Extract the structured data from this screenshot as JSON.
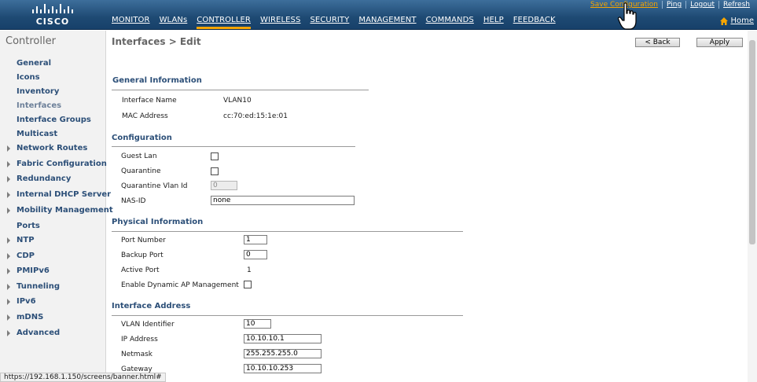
{
  "logo": {
    "text": "CISCO"
  },
  "nav": {
    "items": [
      "MONITOR",
      "WLANs",
      "CONTROLLER",
      "WIRELESS",
      "SECURITY",
      "MANAGEMENT",
      "COMMANDS",
      "HELP",
      "FEEDBACK"
    ],
    "active": "CONTROLLER"
  },
  "toplinks": {
    "save": "Save Configuration",
    "ping": "Ping",
    "logout": "Logout",
    "refresh": "Refresh"
  },
  "home": "Home",
  "sidebar": {
    "title": "Controller",
    "items": [
      {
        "label": "General",
        "expandable": false
      },
      {
        "label": "Icons",
        "expandable": false
      },
      {
        "label": "Inventory",
        "expandable": false
      },
      {
        "label": "Interfaces",
        "expandable": false,
        "selected": true
      },
      {
        "label": "Interface Groups",
        "expandable": false
      },
      {
        "label": "Multicast",
        "expandable": false
      },
      {
        "label": "Network Routes",
        "expandable": true
      },
      {
        "label": "Fabric Configuration",
        "expandable": true
      },
      {
        "label": "Redundancy",
        "expandable": true
      },
      {
        "label": "Internal DHCP Server",
        "expandable": true
      },
      {
        "label": "Mobility Management",
        "expandable": true
      },
      {
        "label": "Ports",
        "expandable": false
      },
      {
        "label": "NTP",
        "expandable": true
      },
      {
        "label": "CDP",
        "expandable": true
      },
      {
        "label": "PMIPv6",
        "expandable": true
      },
      {
        "label": "Tunneling",
        "expandable": true
      },
      {
        "label": "IPv6",
        "expandable": true
      },
      {
        "label": "mDNS",
        "expandable": true
      },
      {
        "label": "Advanced",
        "expandable": true
      }
    ]
  },
  "page": {
    "breadcrumb": "Interfaces > Edit",
    "back": "< Back",
    "apply": "Apply"
  },
  "general": {
    "title": "General Information",
    "interface_name_label": "Interface Name",
    "interface_name": "VLAN10",
    "mac_label": "MAC Address",
    "mac": "cc:70:ed:15:1e:01"
  },
  "configuration": {
    "title": "Configuration",
    "guest_lan_label": "Guest Lan",
    "guest_lan": false,
    "quarantine_label": "Quarantine",
    "quarantine": false,
    "quarantine_vlan_label": "Quarantine Vlan Id",
    "quarantine_vlan": "0",
    "nas_id_label": "NAS-ID",
    "nas_id": "none"
  },
  "physical": {
    "title": "Physical Information",
    "port_number_label": "Port Number",
    "port_number": "1",
    "backup_port_label": "Backup Port",
    "backup_port": "0",
    "active_port_label": "Active Port",
    "active_port": "1",
    "dynamic_ap_label": "Enable Dynamic AP Management",
    "dynamic_ap": false
  },
  "address": {
    "title": "Interface Address",
    "vlan_id_label": "VLAN Identifier",
    "vlan_id": "10",
    "ip_label": "IP Address",
    "ip": "10.10.10.1",
    "netmask_label": "Netmask",
    "netmask": "255.255.255.0",
    "gateway_label": "Gateway",
    "gateway": "10.10.10.253"
  },
  "status_bar": "https://192.168.1.150/screens/banner.html#",
  "colors": {
    "topbar": "#1e4a73",
    "accent": "#f6a500",
    "link": "#2c4f78"
  }
}
